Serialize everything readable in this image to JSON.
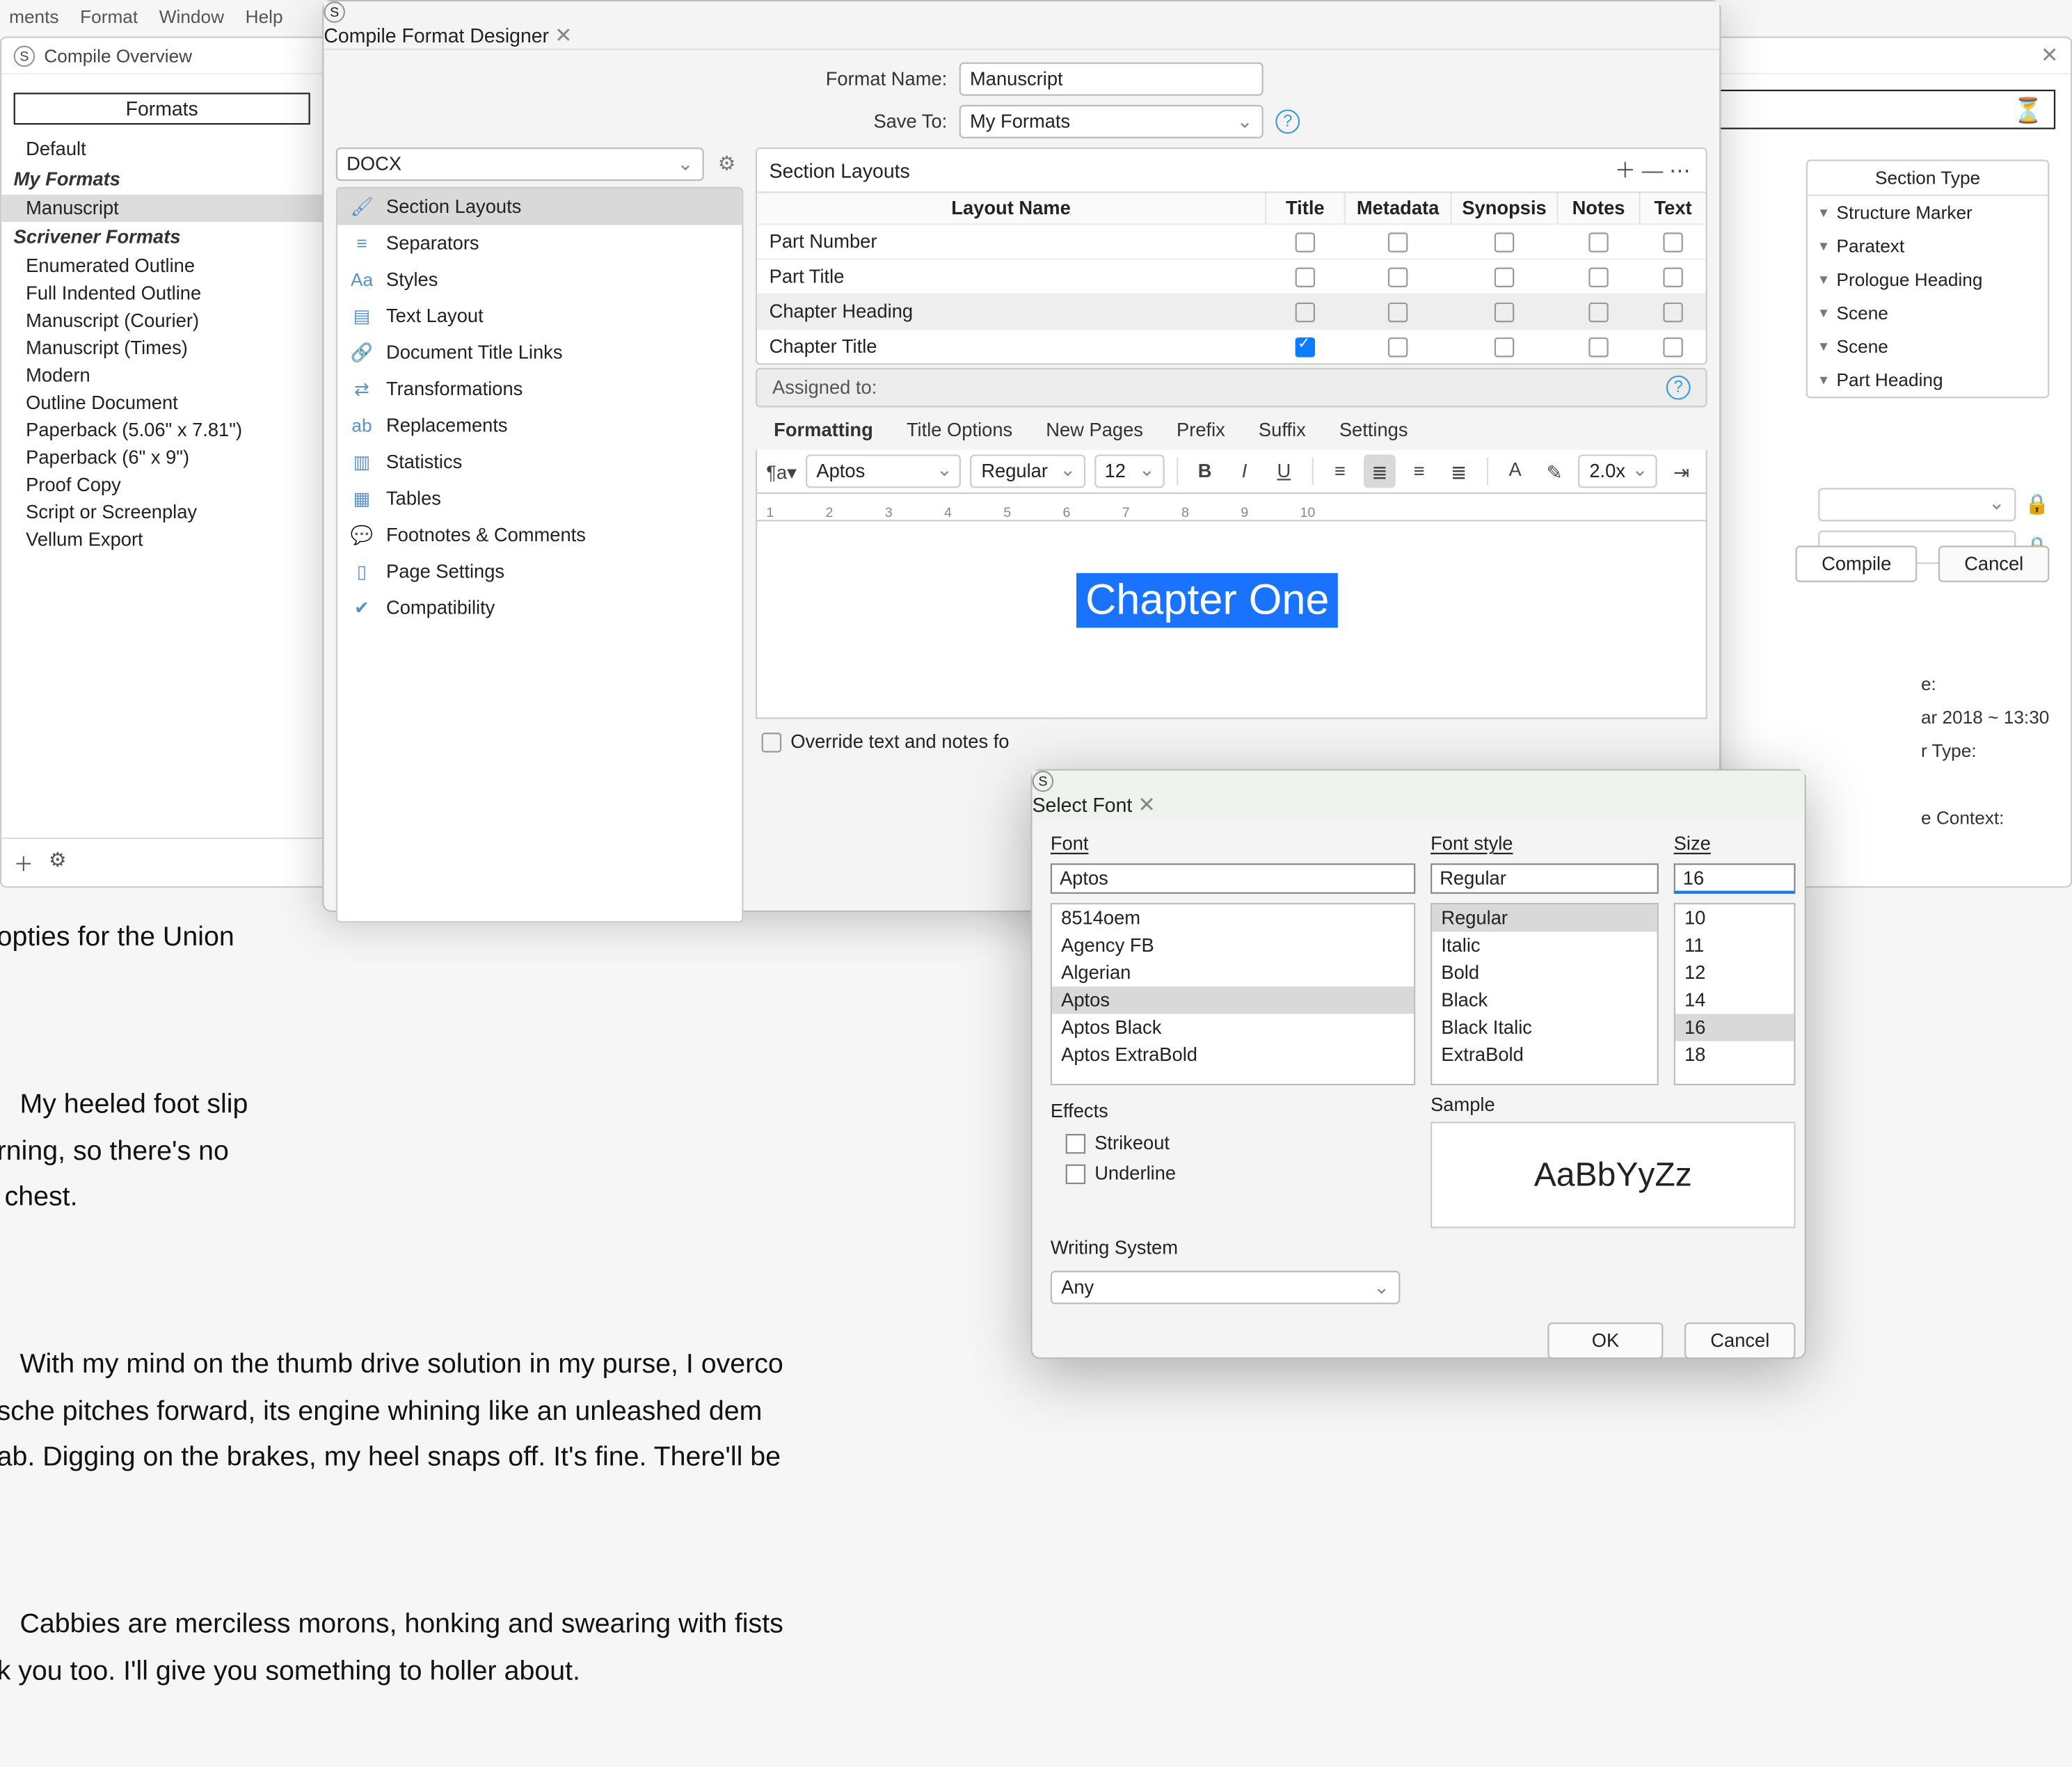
{
  "menubar": {
    "items": [
      "ments",
      "Format",
      "Window",
      "Help"
    ]
  },
  "overview": {
    "title": "Compile Overview",
    "formats_header": "Formats",
    "default": "Default",
    "my_formats_label": "My Formats",
    "my_formats": [
      "Manuscript"
    ],
    "scrivener_formats_label": "Scrivener Formats",
    "scrivener_formats": [
      "Enumerated Outline",
      "Full Indented Outline",
      "Manuscript (Courier)",
      "Manuscript (Times)",
      "Modern",
      "Outline Document",
      "Paperback (5.06\" x 7.81\")",
      "Paperback (6\" x 9\")",
      "Proof Copy",
      "Script or Screenplay",
      "Vellum Export"
    ],
    "section_type_header": "Section Type",
    "section_types": [
      "Structure Marker",
      "Paratext",
      "Prologue Heading",
      "Scene",
      "Scene",
      "Part Heading"
    ],
    "compile_btn": "Compile",
    "cancel_btn": "Cancel",
    "meta_date_label": "e:",
    "meta_date_value": "ar 2018 ~ 13:30",
    "meta_type_label": "r Type:",
    "meta_context_label": "e Context:"
  },
  "designer": {
    "title": "Compile Format Designer",
    "format_name_label": "Format Name:",
    "format_name_value": "Manuscript",
    "save_to_label": "Save To:",
    "save_to_value": "My Formats",
    "filetype": "DOCX",
    "options": [
      "Section Layouts",
      "Separators",
      "Styles",
      "Text Layout",
      "Document Title Links",
      "Transformations",
      "Replacements",
      "Statistics",
      "Tables",
      "Footnotes & Comments",
      "Page Settings",
      "Compatibility"
    ],
    "section_layouts_header": "Section Layouts",
    "columns": [
      "Layout Name",
      "Title",
      "Metadata",
      "Synopsis",
      "Notes",
      "Text"
    ],
    "rows": [
      {
        "name": "Part Number",
        "checks": [
          false,
          false,
          false,
          false,
          false
        ]
      },
      {
        "name": "Part Title",
        "checks": [
          false,
          false,
          false,
          false,
          false
        ]
      },
      {
        "name": "Chapter Heading",
        "checks": [
          false,
          false,
          false,
          false,
          false
        ],
        "selected": true
      },
      {
        "name": "Chapter Title",
        "checks": [
          true,
          false,
          false,
          false,
          false
        ]
      }
    ],
    "assigned_to_label": "Assigned to:",
    "tabs": [
      "Formatting",
      "Title Options",
      "New Pages",
      "Prefix",
      "Suffix",
      "Settings"
    ],
    "toolbar": {
      "font": "Aptos",
      "weight": "Regular",
      "size": "12",
      "linespacing": "2.0x"
    },
    "ruler_marks": [
      "1",
      "2",
      "3",
      "4",
      "5",
      "6",
      "7",
      "8",
      "9",
      "10"
    ],
    "chapter_sample": "Chapter One",
    "override_label": "Override text and notes fo"
  },
  "fontdlg": {
    "title": "Select Font",
    "font_label": "Font",
    "font_value": "Aptos",
    "fonts": [
      "8514oem",
      "Agency FB",
      "Algerian",
      "Aptos",
      "Aptos Black",
      "Aptos ExtraBold"
    ],
    "style_label": "Font style",
    "style_value": "Regular",
    "styles": [
      "Regular",
      "Italic",
      "Bold",
      "Black",
      "Black Italic",
      "ExtraBold"
    ],
    "size_label": "Size",
    "size_value": "16",
    "sizes": [
      "10",
      "11",
      "12",
      "14",
      "16",
      "18"
    ],
    "effects_label": "Effects",
    "strikeout": "Strikeout",
    "underline": "Underline",
    "sample_label": "Sample",
    "sample_value": "AaBbYyZz",
    "ws_label": "Writing System",
    "ws_value": "Any",
    "ok": "OK",
    "cancel": "Cancel"
  },
  "bgtext": {
    "p0": "opties for the Union",
    "p1": "   My heeled foot slip\nrning, so there's no\n chest.",
    "p2": "   With my mind on the thumb drive solution in my purse, I overco\nsche pitches forward, its engine whining like an unleashed dem\nab. Digging on the brakes, my heel snaps off. It's fine. There'll be",
    "p3": "   Cabbies are merciless morons, honking and swearing with fists\nk you too. I'll give you something to holler about."
  }
}
